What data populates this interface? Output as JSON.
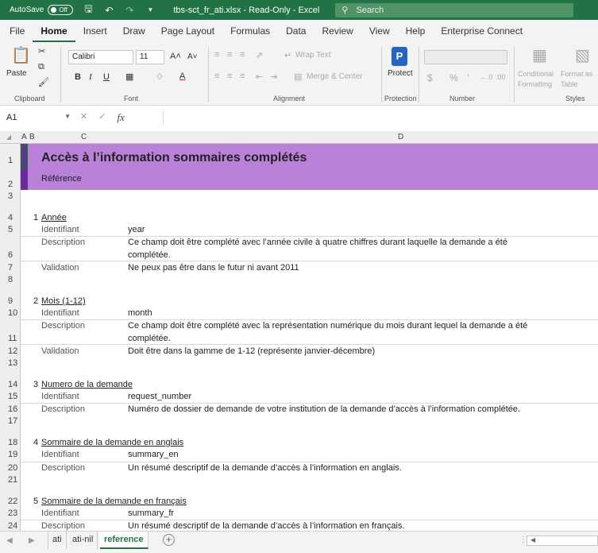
{
  "titlebar": {
    "autosave_label": "AutoSave",
    "autosave_state": "Off",
    "doc_title": "tbs-sct_fr_ati.xlsx  -  Read-Only  -  Excel",
    "search_placeholder": "Search"
  },
  "menu": {
    "tabs": [
      "File",
      "Home",
      "Insert",
      "Draw",
      "Page Layout",
      "Formulas",
      "Data",
      "Review",
      "View",
      "Help",
      "Enterprise Connect"
    ],
    "active": "Home"
  },
  "ribbon": {
    "paste_label": "Paste",
    "font_name": "Calibri",
    "font_size": "11",
    "increase_font": "A˄",
    "decrease_font": "A˅",
    "bold": "B",
    "italic": "I",
    "underline": "U",
    "wrap_text": "Wrap Text",
    "merge_center": "Merge & Center",
    "protect_label": "Protect",
    "currency": "$",
    "percent": "%",
    "comma": "’",
    "conditional_formatting": "Conditional Formatting",
    "format_as_table": "Format as Table",
    "groups": {
      "clipboard": "Clipboard",
      "font": "Font",
      "alignment": "Alignment",
      "protection": "Protection",
      "number": "Number",
      "styles": "Styles"
    }
  },
  "formula_bar": {
    "name_box": "A1",
    "fx": "fx",
    "value": ""
  },
  "columns": [
    "A",
    "B",
    "C",
    "D"
  ],
  "banner": {
    "title": "Accès à l’information sommaires complétés",
    "subtitle": "Référence"
  },
  "rows": [
    "1",
    "2",
    "3",
    "4",
    "5",
    "6",
    "7",
    "8",
    "9",
    "10",
    "11",
    "12",
    "13",
    "14",
    "15",
    "16",
    "17",
    "18",
    "19",
    "20",
    "21",
    "22",
    "23",
    "24"
  ],
  "sections": [
    {
      "num": "1",
      "title": "Année",
      "fields": [
        {
          "label": "Identifiant",
          "lines": [
            "year"
          ]
        },
        {
          "label": "Description",
          "lines": [
            "Ce champ doit être complété avec l’année civile à quatre chiffres durant laquelle la demande a été",
            "complétée."
          ]
        },
        {
          "label": "Validation",
          "lines": [
            "Ne peux pas être dans le futur ni avant 2011"
          ]
        }
      ]
    },
    {
      "num": "2",
      "title": "Mois (1-12)",
      "fields": [
        {
          "label": "Identifiant",
          "lines": [
            "month"
          ]
        },
        {
          "label": "Description",
          "lines": [
            "Ce champ doit être complété avec la représentation numérique du mois durant lequel la demande a été",
            "complétée."
          ]
        },
        {
          "label": "Validation",
          "lines": [
            "Doit être dans la gamme de 1-12 (représente janvier-décembre)"
          ]
        }
      ]
    },
    {
      "num": "3",
      "title": "Numero de la demande",
      "fields": [
        {
          "label": "Identifiant",
          "lines": [
            "request_number"
          ]
        },
        {
          "label": "Description",
          "lines": [
            "Numéro de dossier de demande de votre institution de la demande d’accès à l’information complétée."
          ]
        }
      ]
    },
    {
      "num": "4",
      "title": "Sommaire de la demande en anglais",
      "fields": [
        {
          "label": "Identifiant",
          "lines": [
            "summary_en"
          ]
        },
        {
          "label": "Description",
          "lines": [
            "Un résumé descriptif de la demande d’accès à l’information en anglais."
          ]
        }
      ]
    },
    {
      "num": "5",
      "title": "Sommaire de la demande en français",
      "fields": [
        {
          "label": "Identifiant",
          "lines": [
            "summary_fr"
          ]
        },
        {
          "label": "Description",
          "lines": [
            "Un résumé descriptif de la demande d’accès à l’information en français."
          ]
        }
      ]
    }
  ],
  "sheets": [
    "ati",
    "ati-nil",
    "reference"
  ],
  "active_sheet": "reference",
  "colors": {
    "excel_green": "#217346",
    "banner_purple": "#b981d8",
    "banner_accent": "#6a2aa0"
  }
}
